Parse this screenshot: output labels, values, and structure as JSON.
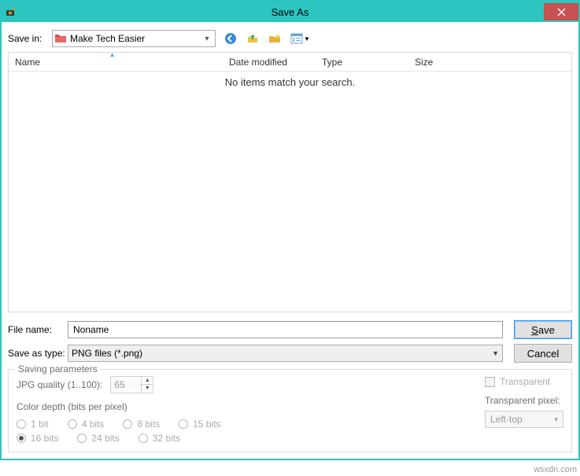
{
  "window": {
    "title": "Save As"
  },
  "toolbar": {
    "save_in_label": "Save in:",
    "folder_name": "Make Tech Easier"
  },
  "columns": {
    "name": "Name",
    "date": "Date modified",
    "type": "Type",
    "size": "Size"
  },
  "list": {
    "empty_text": "No items match your search."
  },
  "form": {
    "file_name_label": "File name:",
    "file_name_value": "Noname",
    "file_type_label": "Save as type:",
    "file_type_value": "PNG files (*.png)",
    "save_button": "Save",
    "cancel_button": "Cancel"
  },
  "params": {
    "legend": "Saving parameters",
    "jpg_label": "JPG quality (1..100):",
    "jpg_value": "65",
    "color_depth_label": "Color depth (bits per pixel)",
    "radios": [
      "1 bit",
      "4 bits",
      "8 bits",
      "15 bits",
      "16 bits",
      "24 bits",
      "32 bits"
    ],
    "radio_selected": "16 bits",
    "transparent_label": "Transparent",
    "transparent_pixel_label": "Transparent pixel:",
    "transparent_pixel_value": "Left-top"
  },
  "watermark": "wsxdn.com"
}
